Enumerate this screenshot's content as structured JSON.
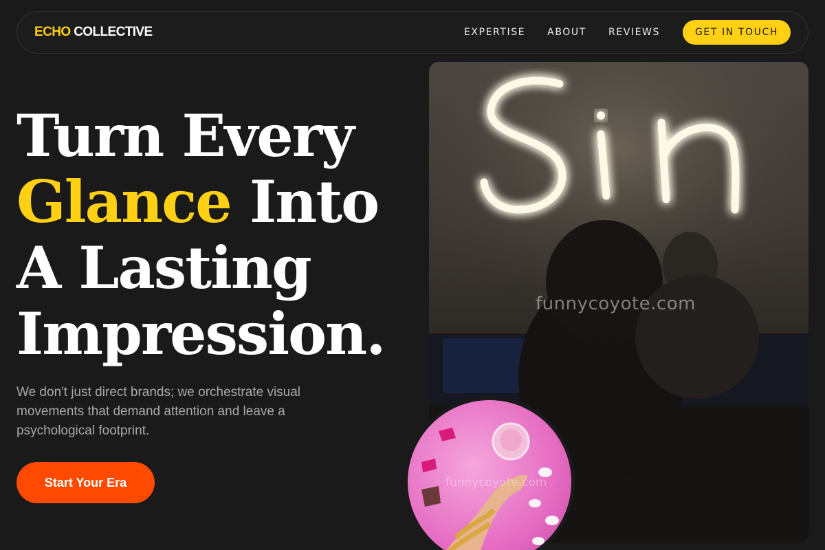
{
  "brand": {
    "logo_part1": "ECHO",
    "logo_part2": "COLLECTIVE",
    "accent_color": "#ffd013",
    "cta_color": "#ff4a00"
  },
  "nav": {
    "links": [
      "EXPERTISE",
      "ABOUT",
      "REVIEWS"
    ],
    "cta_label": "GET IN TOUCH"
  },
  "hero": {
    "headline": {
      "line1": "Turn Every",
      "line2_highlight": "Glance",
      "line2_rest": " Into",
      "line3": "A Lasting",
      "line4": "Impression."
    },
    "subtext": "We don't just direct brands; we orchestrate visual movements that demand attention and leave a psychological footprint.",
    "button_label": "Start Your Era"
  },
  "images": {
    "main_watermark": "funnycoyote.com",
    "circle_watermark": "funnycoyote.com",
    "neon_sign": "neon-sign-sin",
    "circle_subject": "hand-with-gold-jewelry-on-pink-fur"
  }
}
